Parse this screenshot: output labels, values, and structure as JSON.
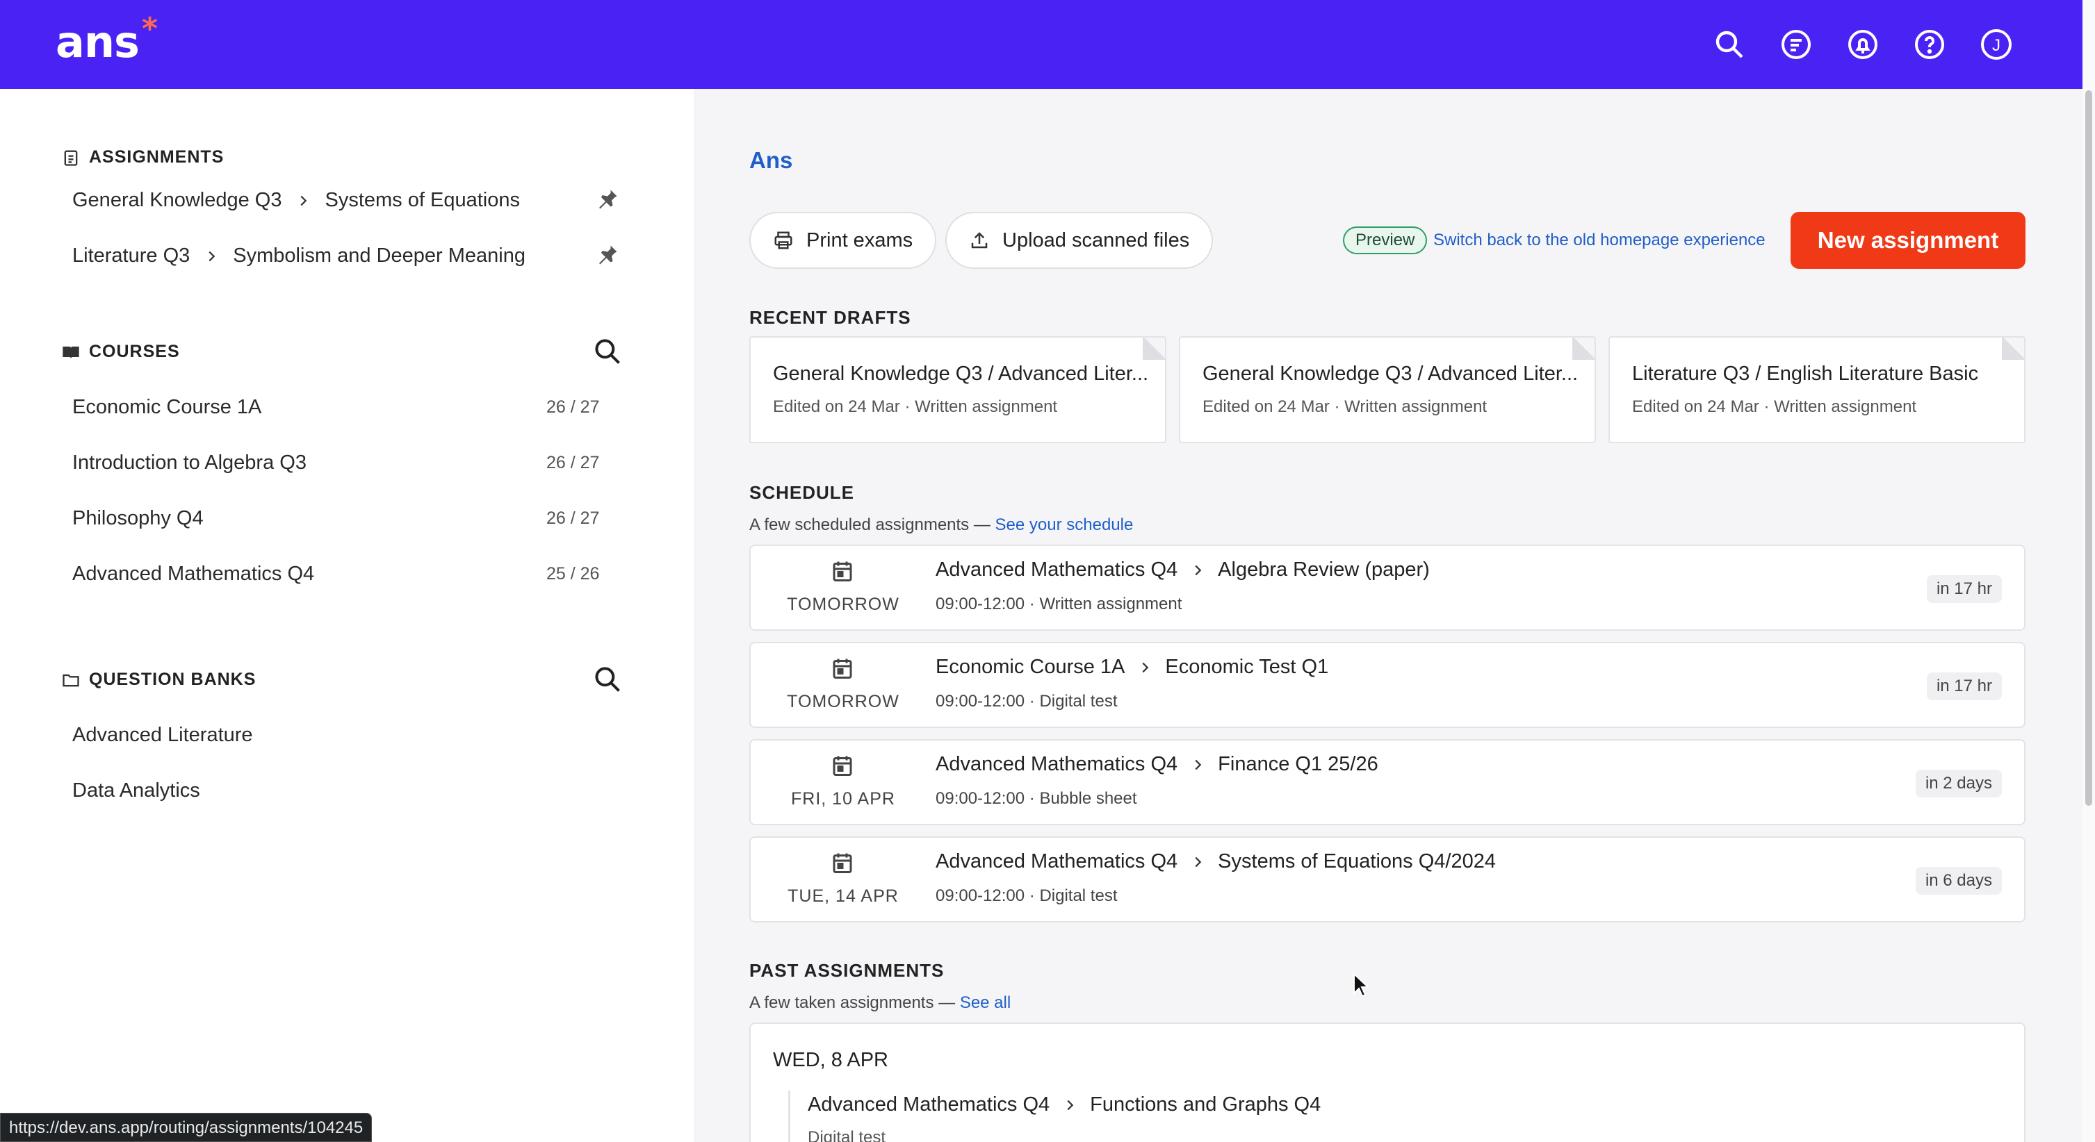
{
  "app": {
    "logo": "ans",
    "logo_mark": "*"
  },
  "topbar_icons": [
    "search-icon",
    "chat-icon",
    "bell-icon",
    "help-icon",
    "avatar"
  ],
  "user": {
    "avatar_initial": "J"
  },
  "sidebar": {
    "assignments": {
      "title": "ASSIGNMENTS",
      "items": [
        {
          "course": "General Knowledge Q3",
          "name": "Systems of Equations"
        },
        {
          "course": "Literature Q3",
          "name": "Symbolism and Deeper Meaning"
        }
      ]
    },
    "courses": {
      "title": "COURSES",
      "items": [
        {
          "name": "Economic Course 1A",
          "count": "26 / 27"
        },
        {
          "name": "Introduction to Algebra Q3",
          "count": "26 / 27"
        },
        {
          "name": "Philosophy Q4",
          "count": "26 / 27"
        },
        {
          "name": "Advanced Mathematics Q4",
          "count": "25 / 26"
        }
      ]
    },
    "question_banks": {
      "title": "QUESTION BANKS",
      "items": [
        {
          "name": "Advanced Literature"
        },
        {
          "name": "Data Analytics"
        }
      ]
    }
  },
  "main": {
    "title": "Ans",
    "actions": {
      "print": "Print exams",
      "upload": "Upload scanned files",
      "preview_badge": "Preview",
      "switch_link": "Switch back to the old homepage experience",
      "new_assignment": "New assignment"
    },
    "recent_drafts": {
      "title": "RECENT DRAFTS",
      "items": [
        {
          "title": "General Knowledge Q3 / Advanced Liter...",
          "meta": "Edited on 24 Mar · Written assignment"
        },
        {
          "title": "General Knowledge Q3 / Advanced Liter...",
          "meta": "Edited on 24 Mar · Written assignment"
        },
        {
          "title": "Literature Q3 / English Literature Basic",
          "meta": "Edited on 24 Mar · Written assignment"
        }
      ]
    },
    "schedule": {
      "title": "SCHEDULE",
      "subtitle": "A few scheduled assignments — ",
      "link": "See your schedule",
      "items": [
        {
          "date": "TOMORROW",
          "course": "Advanced Mathematics Q4",
          "name": "Algebra Review (paper)",
          "meta": "09:00-12:00 · Written assignment",
          "when": "in 17 hr"
        },
        {
          "date": "TOMORROW",
          "course": "Economic Course 1A",
          "name": "Economic Test Q1",
          "meta": "09:00-12:00 · Digital test",
          "when": "in 17 hr"
        },
        {
          "date": "FRI, 10 APR",
          "course": "Advanced Mathematics Q4",
          "name": "Finance Q1 25/26",
          "meta": "09:00-12:00 · Bubble sheet",
          "when": "in 2 days"
        },
        {
          "date": "TUE, 14 APR",
          "course": "Advanced Mathematics Q4",
          "name": "Systems of Equations Q4/2024",
          "meta": "09:00-12:00 · Digital test",
          "when": "in 6 days"
        }
      ]
    },
    "past": {
      "title": "PAST ASSIGNMENTS",
      "subtitle": "A few taken assignments — ",
      "link": "See all",
      "date": "WED, 8 APR",
      "course": "Advanced Mathematics Q4",
      "name": "Functions and Graphs Q4",
      "meta": "Digital test"
    }
  },
  "status_url": "https://dev.ans.app/routing/assignments/104245",
  "colors": {
    "brand": "#4b22f4",
    "accent": "#f03a17",
    "link": "#1f5fc9",
    "preview": "#2d9e6a"
  }
}
